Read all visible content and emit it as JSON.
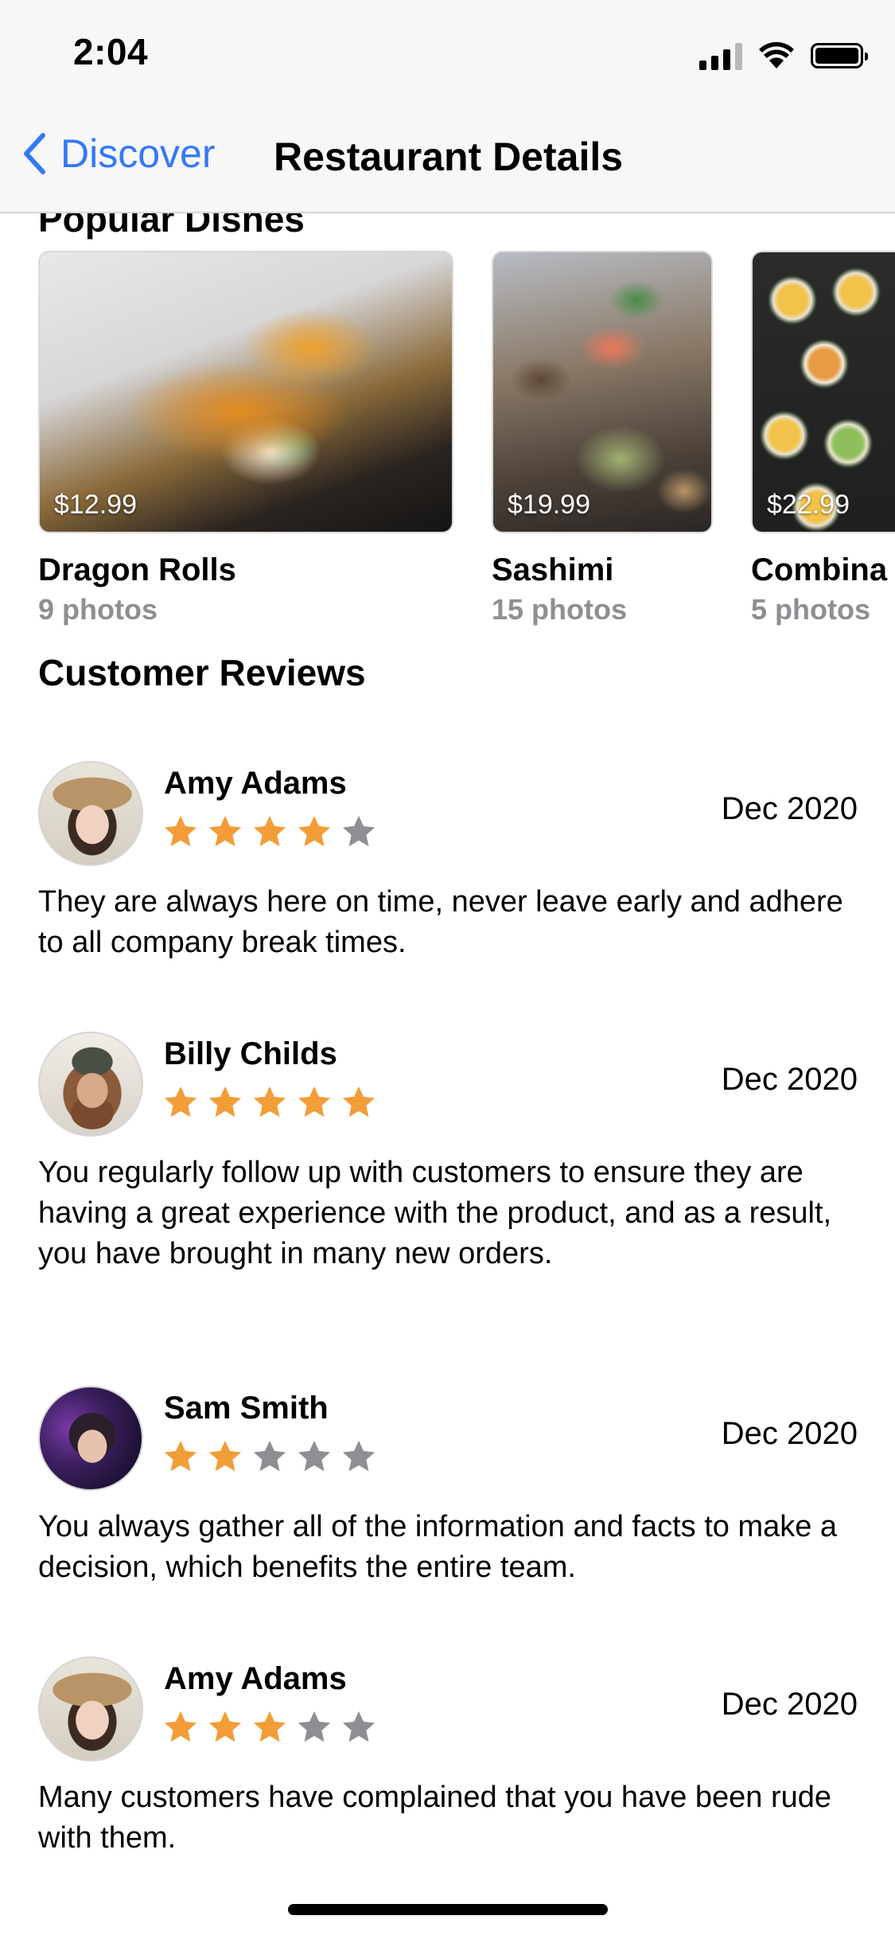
{
  "status_bar": {
    "time": "2:04"
  },
  "nav": {
    "back_label": "Discover",
    "title": "Restaurant Details"
  },
  "photos_section": {
    "title": "Popular Dishes"
  },
  "dishes": [
    {
      "name": "Dragon Rolls",
      "count": "9 photos",
      "price": "$12.99"
    },
    {
      "name": "Sashimi",
      "count": "15 photos",
      "price": "$19.99"
    },
    {
      "name": "Combina",
      "count": "5 photos",
      "price": "$22.99"
    }
  ],
  "reviews_section": {
    "title": "Customer Reviews"
  },
  "reviews": [
    {
      "name": "Amy Adams",
      "rating": 4,
      "date": "Dec 2020",
      "text": "They are always here on time, never leave early and adhere to all company break times."
    },
    {
      "name": "Billy Childs",
      "rating": 5,
      "date": "Dec 2020",
      "text": "You regularly follow up with customers to ensure they are having a great experience with the product, and as a result, you have brought in many new orders."
    },
    {
      "name": "Sam Smith",
      "rating": 2,
      "date": "Dec 2020",
      "text": "You always gather all of the information and facts to make a decision, which benefits the entire team."
    },
    {
      "name": "Amy Adams",
      "rating": 3,
      "date": "Dec 2020",
      "text": "Many customers have complained that you have been rude with them."
    }
  ],
  "colors": {
    "accent": "#3478f6",
    "star_filled": "#f29d38",
    "star_empty": "#8e8e93",
    "secondary_text": "#8e8e93"
  },
  "icons": {
    "back": "chevron-left-icon",
    "star": "star-icon",
    "signal": "cellular-signal-icon",
    "wifi": "wifi-icon",
    "battery": "battery-icon"
  }
}
